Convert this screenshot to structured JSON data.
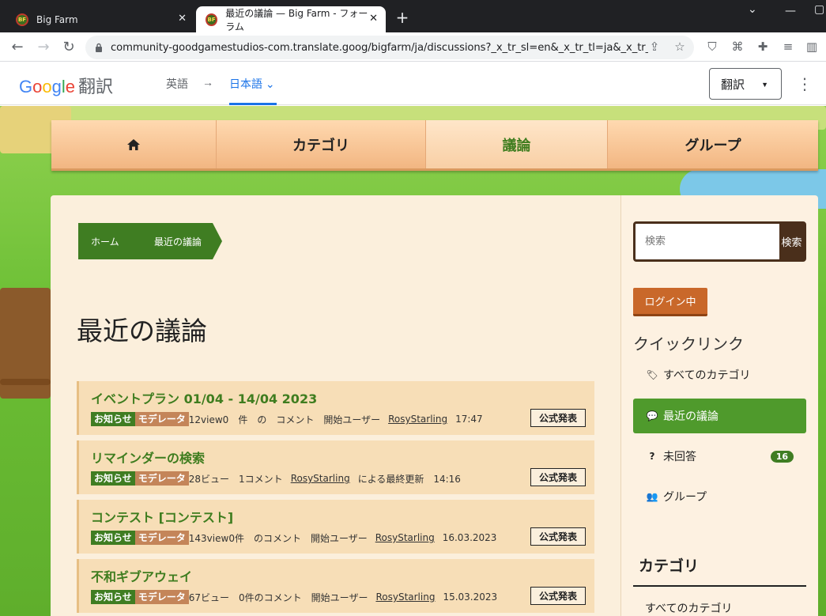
{
  "browser": {
    "tabs": [
      {
        "title": "Big Farm",
        "active": false
      },
      {
        "title": "最近の議論 — Big Farm - フォーラム",
        "active": true
      }
    ],
    "favicon_text": "BF",
    "url": "community-goodgamestudios-com.translate.goog/bigfarm/ja/discussions?_x_tr_sl=en&_x_tr_tl=ja&_x_tr_h..."
  },
  "translate_bar": {
    "logo": "Google",
    "logo_suffix": "翻訳",
    "source_lang": "英語",
    "arrow": "→",
    "target_lang": "日本語",
    "button_label": "翻訳"
  },
  "nav": {
    "items": [
      {
        "label": "",
        "icon": "home-icon"
      },
      {
        "label": "カテゴリ"
      },
      {
        "label": "議論",
        "active": true
      },
      {
        "label": "グループ"
      }
    ]
  },
  "breadcrumb": [
    "ホーム",
    "最近の議論"
  ],
  "page_title": "最近の議論",
  "discussions": [
    {
      "title": "イベントプラン 01/04 - 14/04 2023",
      "badges": [
        "お知らせ",
        "モデレータ"
      ],
      "meta_pre": "12view0　件　の　コメント　開始ユーザー",
      "user": "RosyStarling",
      "meta_post": "17:47",
      "tag": "公式発表"
    },
    {
      "title": "リマインダーの検索",
      "badges": [
        "お知らせ",
        "モデレータ"
      ],
      "meta_pre": "28ビュー　1コメント",
      "user": "RosyStarling",
      "meta_post": "による最終更新　14:16",
      "tag": "公式発表"
    },
    {
      "title": "コンテスト [コンテスト]",
      "badges": [
        "お知らせ",
        "モデレータ"
      ],
      "meta_pre": "143view0件　のコメント　開始ユーザー",
      "user": "RosyStarling",
      "meta_post": "16.03.2023",
      "tag": "公式発表"
    },
    {
      "title": "不和ギブアウェイ",
      "badges": [
        "お知らせ",
        "モデレータ"
      ],
      "meta_pre": "67ビュー　0件のコメント　開始ユーザー",
      "user": "RosyStarling",
      "meta_post": "15.03.2023",
      "tag": "公式発表"
    }
  ],
  "sidebar": {
    "search_placeholder": "検索",
    "search_button": "検索",
    "login_label": "ログイン中",
    "quicklinks_title": "クイックリンク",
    "quicklinks": [
      {
        "label": "すべてのカテゴリ",
        "icon": "tags-icon"
      },
      {
        "label": "最近の議論",
        "icon": "comments-icon",
        "active": true
      },
      {
        "label": "未回答",
        "icon": "question-icon",
        "count": "16"
      },
      {
        "label": "グループ",
        "icon": "users-icon"
      }
    ],
    "categories_title": "カテゴリ",
    "categories_all": "すべてのカテゴリ"
  },
  "colors": {
    "accent_green": "#3f7d22",
    "moderator": "#c48559",
    "login": "#c9682a",
    "search_dark": "#4a2f1b"
  }
}
